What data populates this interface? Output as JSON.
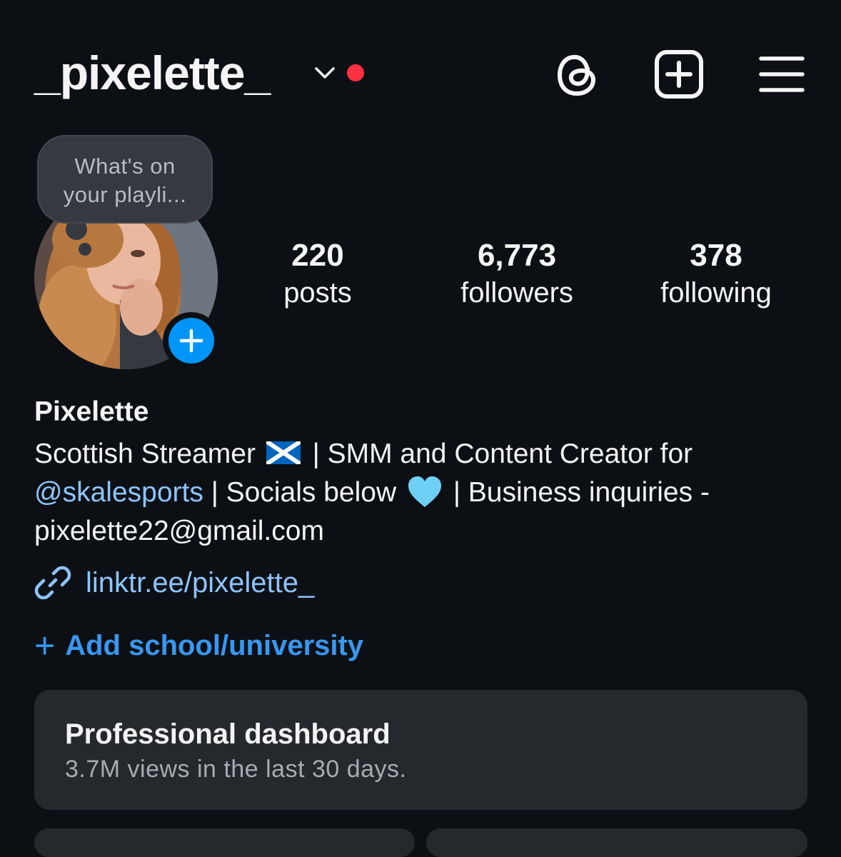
{
  "header": {
    "username": "_pixelette_",
    "icons": [
      "chevron-down-icon",
      "notification-dot",
      "threads-icon",
      "create-post-icon",
      "menu-icon"
    ],
    "notification_color": "#ff3040"
  },
  "note": {
    "text_line1": "What's on",
    "text_line2": "your playli..."
  },
  "stats": {
    "posts": {
      "value": "220",
      "label": "posts"
    },
    "followers": {
      "value": "6,773",
      "label": "followers"
    },
    "following": {
      "value": "378",
      "label": "following"
    }
  },
  "profile": {
    "display_name": "Pixelette",
    "bio_line1_a": "Scottish Streamer",
    "bio_line1_b": "| SMM and Content Creator for",
    "bio_mention": "@skalesports",
    "bio_line2_b": "| Socials below",
    "bio_line2_c": "| Business inquiries -",
    "bio_email": "pixelette22@gmail.com",
    "link": "linktr.ee/pixelette_",
    "add_school": "Add school/university"
  },
  "dashboard": {
    "title": "Professional dashboard",
    "subtitle": "3.7M views in the last 30 days."
  },
  "colors": {
    "background": "#0c1014",
    "accent_blue": "#0095f6",
    "link_blue": "#8ec4ff",
    "card": "#25292e"
  }
}
